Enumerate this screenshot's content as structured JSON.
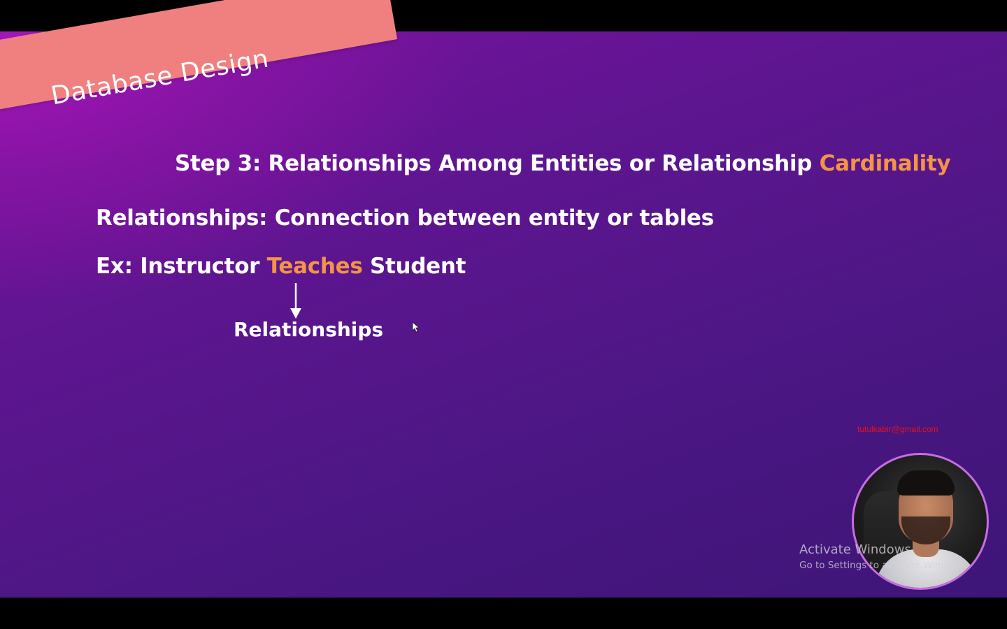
{
  "banner": {
    "label": "Database Design",
    "color": "#f08080"
  },
  "step_title": {
    "prefix": "Step 3: Relationships Among Entities or Relationship ",
    "highlight": "Cardinality"
  },
  "definition": {
    "text": "Relationships: Connection between entity or tables"
  },
  "example": {
    "prefix": "Ex: Instructor ",
    "highlight": "Teaches",
    "suffix": " Student"
  },
  "arrow_label": "Relationships",
  "watermark_email": "tutulkabir@gmail.com",
  "activation_notice": {
    "title": "Activate Windows",
    "subtitle": "Go to Settings to activate Windows."
  },
  "colors": {
    "accent": "#f39446",
    "background_top": "#a416b8",
    "background_bottom": "#3d1577",
    "email": "#e8101a",
    "webcam_ring": "#c76de0"
  },
  "icons": {
    "arrow": "down-arrow-icon",
    "cursor": "mouse-pointer-icon"
  }
}
